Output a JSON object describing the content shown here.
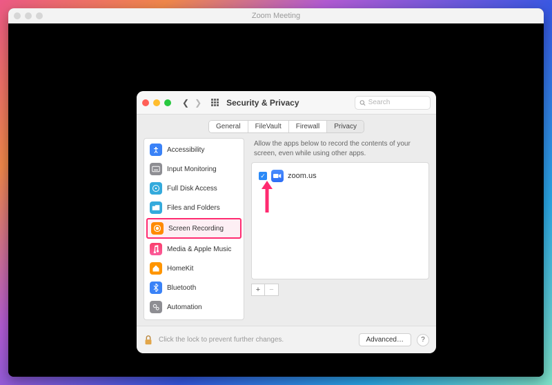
{
  "zoom": {
    "title": "Zoom Meeting"
  },
  "prefs": {
    "title": "Security & Privacy",
    "search_placeholder": "Search",
    "tabs": {
      "general": "General",
      "filevault": "FileVault",
      "firewall": "Firewall",
      "privacy": "Privacy"
    },
    "sidebar": {
      "accessibility": "Accessibility",
      "input_monitoring": "Input Monitoring",
      "full_disk_access": "Full Disk Access",
      "files_and_folders": "Files and Folders",
      "screen_recording": "Screen Recording",
      "media_apple_music": "Media & Apple Music",
      "homekit": "HomeKit",
      "bluetooth": "Bluetooth",
      "automation": "Automation"
    },
    "description": "Allow the apps below to record the contents of your screen, even while using other apps.",
    "apps": {
      "zoom": "zoom.us"
    },
    "add_label": "+",
    "remove_label": "−",
    "footer": {
      "lock_text": "Click the lock to prevent further changes.",
      "advanced": "Advanced…",
      "help": "?"
    }
  }
}
